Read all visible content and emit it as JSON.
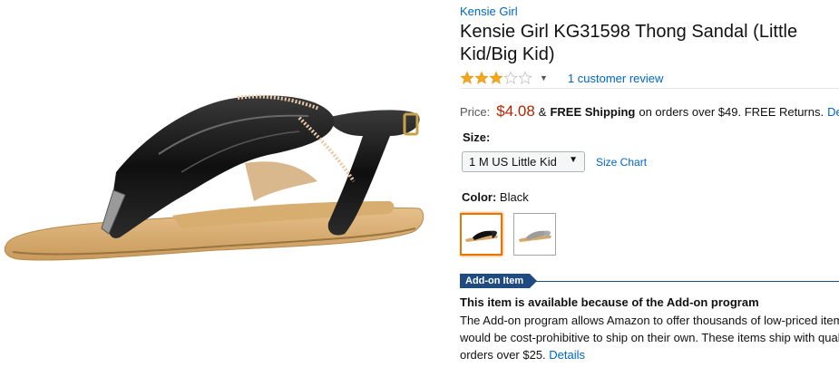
{
  "product": {
    "brand": "Kensie Girl",
    "title": "Kensie Girl KG31598 Thong Sandal (Little Kid/Big Kid)",
    "rating": {
      "stars": 3,
      "max": 5,
      "review_count_text": "1 customer review"
    }
  },
  "pricing": {
    "label": "Price:",
    "price": "$4.08",
    "amp": "&",
    "free_shipping": "FREE Shipping",
    "shipping_suffix": "on orders over $49. FREE Returns.",
    "details_cut": "De"
  },
  "size": {
    "label": "Size:",
    "selected": "1 M US Little Kid",
    "size_chart_link": "Size Chart"
  },
  "color": {
    "label": "Color:",
    "selected": "Black",
    "swatches": [
      "black",
      "silver"
    ]
  },
  "addon": {
    "badge": "Add-on Item",
    "heading": "This item is available because of the Add-on program",
    "line1": "The Add-on program allows Amazon to offer thousands of low-priced items",
    "line2": "would be cost-prohibitive to ship on their own. These items ship with qualifying",
    "line3": "orders over $25.",
    "details_link": "Details"
  },
  "colors": {
    "link": "#0066c0",
    "price": "#b12704",
    "star": "#f4a81d",
    "addon_blue": "#1f4b80",
    "selected_border": "#e77600"
  }
}
